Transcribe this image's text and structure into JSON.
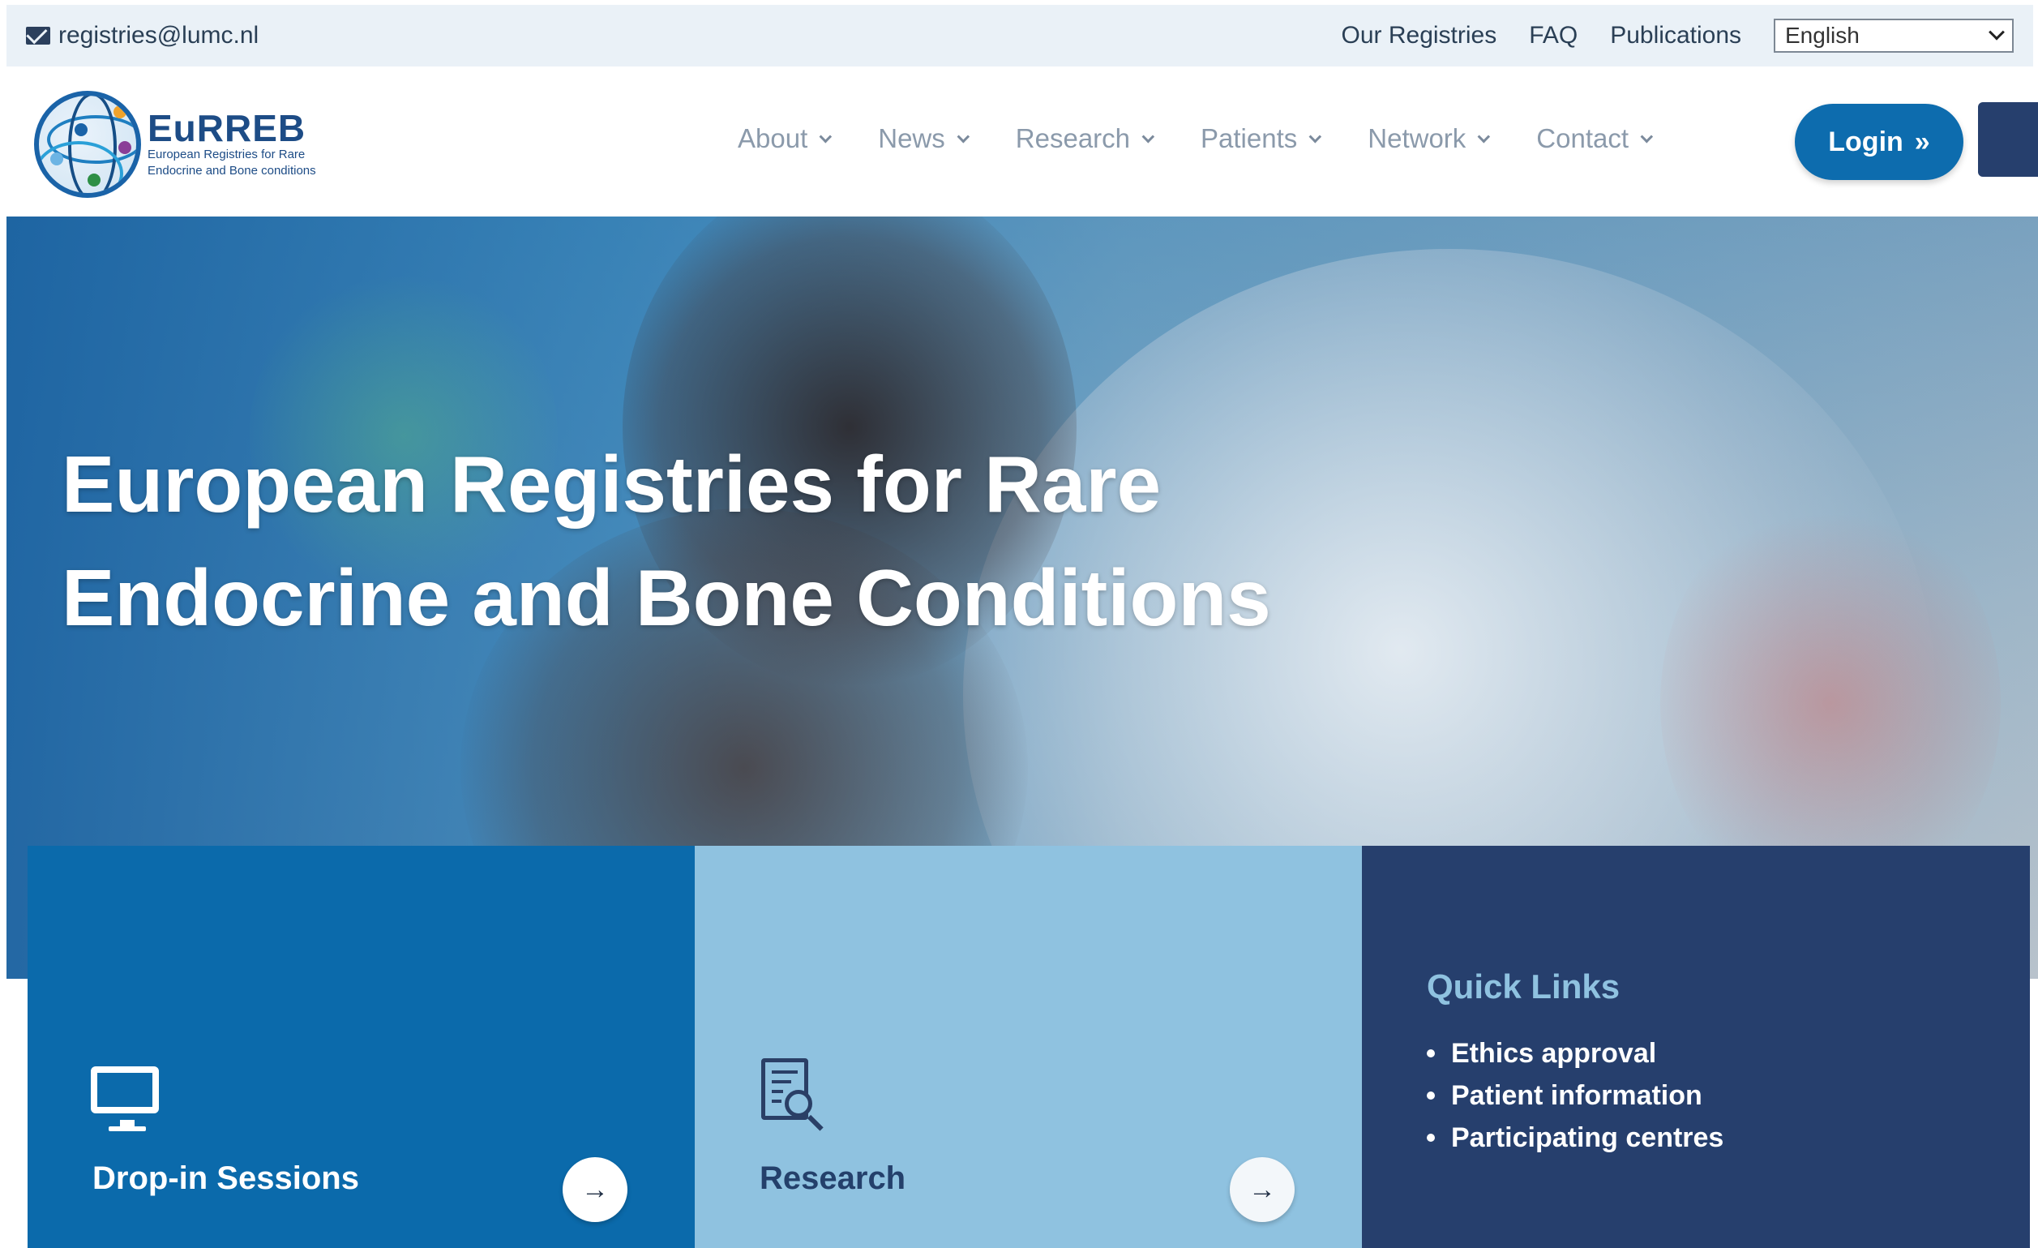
{
  "topbar": {
    "email": "registries@lumc.nl",
    "links": [
      "Our Registries",
      "FAQ",
      "Publications"
    ],
    "language": "English"
  },
  "logo": {
    "title": "EuRREB",
    "subtitle_line1": "European Registries for Rare",
    "subtitle_line2": "Endocrine and Bone conditions"
  },
  "nav": {
    "items": [
      {
        "label": "About"
      },
      {
        "label": "News"
      },
      {
        "label": "Research"
      },
      {
        "label": "Patients"
      },
      {
        "label": "Network"
      },
      {
        "label": "Contact"
      }
    ],
    "login_label": "Login",
    "login_icon": "»"
  },
  "hero": {
    "title_line1": "European Registries for Rare",
    "title_line2": "Endocrine and Bone Conditions"
  },
  "cards": {
    "card1": {
      "title": "Drop-in Sessions",
      "icon": "monitor-icon",
      "arrow": "→"
    },
    "card2": {
      "title": "Research",
      "icon": "document-search-icon",
      "arrow": "→"
    },
    "quick_links": {
      "title": "Quick Links",
      "items": [
        "Ethics approval",
        "Patient information",
        "Participating centres"
      ]
    }
  },
  "colors": {
    "brand_blue": "#0b6aab",
    "light_blue": "#8fc2e0",
    "navy": "#263f6d",
    "topbar_bg": "#eaf1f7"
  }
}
